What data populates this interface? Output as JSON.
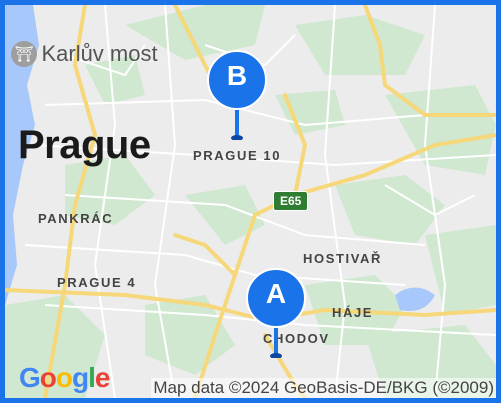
{
  "map": {
    "poi": {
      "label": "Karlův most",
      "icon": "landmark-icon"
    },
    "city_label": "Prague",
    "districts": [
      {
        "key": "prague10",
        "label": "PRAGUE 10"
      },
      {
        "key": "pankrac",
        "label": "PANKRÁC"
      },
      {
        "key": "hostivar",
        "label": "HOSTIVAŘ"
      },
      {
        "key": "prague4",
        "label": "PRAGUE 4"
      },
      {
        "key": "haje",
        "label": "HÁJE"
      },
      {
        "key": "chodov",
        "label": "CHODOV"
      }
    ],
    "road_shield": "E65",
    "markers": [
      {
        "letter": "A",
        "color": "#1a73e8"
      },
      {
        "letter": "B",
        "color": "#1a73e8"
      }
    ],
    "attribution": "Map data ©2024 GeoBasis-DE/BKG (©2009)",
    "logo": {
      "letters": [
        "G",
        "o",
        "o",
        "g",
        "l",
        "e"
      ],
      "colors": [
        "#4285f4",
        "#ea4335",
        "#fbbc05",
        "#4285f4",
        "#34a853",
        "#ea4335"
      ]
    },
    "colors": {
      "water": "#a8c7fa",
      "park": "#c8e6c9",
      "highway": "#f6d77a",
      "road": "#ffffff",
      "border": "#1a73e8"
    }
  }
}
